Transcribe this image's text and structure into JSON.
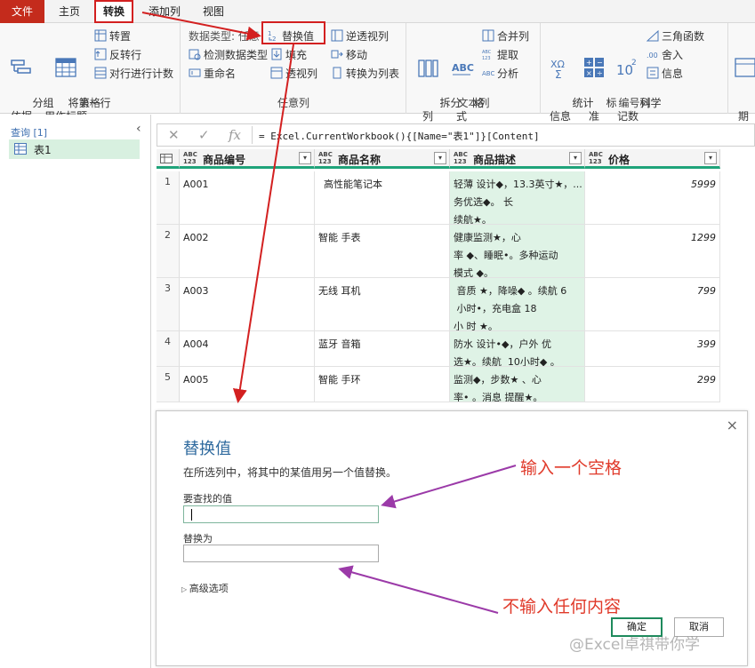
{
  "tabs": {
    "file": "文件",
    "home": "主页",
    "transform": "转换",
    "add_column": "添加列",
    "view": "视图"
  },
  "ribbon": {
    "table_group": {
      "label": "表格",
      "group_by": "分组\n依据",
      "use_first_row": "将第一行\n用作标题",
      "transpose": "转置",
      "reverse_rows": "反转行",
      "count_rows": "对行进行计数"
    },
    "any_column_group": {
      "label": "任意列",
      "data_type": "数据类型: 任意",
      "detect_type": "检测数据类型",
      "rename": "重命名",
      "replace_values": "替换值",
      "fill": "填充",
      "pivot": "透视列",
      "unpivot": "逆透视列",
      "move": "移动",
      "to_list": "转换为列表"
    },
    "text_group": {
      "label": "文本列",
      "split": "拆分\n列",
      "format": "格\n式",
      "merge": "合并列",
      "extract": "提取",
      "parse": "分析"
    },
    "number_group": {
      "label": "编号列",
      "statistics": "统计\n信息",
      "standard": "标\n准",
      "scientific": "科学\n记数",
      "trig": "三角函数",
      "rounding": "舍入",
      "info": "信息"
    },
    "date_group": {
      "date": "日\n期"
    }
  },
  "sidebar": {
    "header": "查询 [1]",
    "query": "表1"
  },
  "formula": {
    "text": "= Excel.CurrentWorkbook(){[Name=\"表1\"]}[Content]"
  },
  "grid": {
    "type_badge": "ABC\n123",
    "headers": [
      "商品编号",
      "商品名称",
      "商品描述",
      "价格"
    ],
    "rows": [
      {
        "n": "1",
        "id": "A001",
        "name": "高性能笔记本",
        "desc": "轻薄 设计◆，13.3英寸★，...\n务优选◆。 长\n续航★。",
        "price": "5999"
      },
      {
        "n": "2",
        "id": "A002",
        "name": "智能 手表",
        "desc": "健康监测★，心\n率 ◆、睡眠•。多种运动\n模式 ◆。",
        "price": "1299"
      },
      {
        "n": "3",
        "id": "A003",
        "name": "无线 耳机",
        "desc": " 音质 ★，降噪◆ 。续航 6\n 小时•，充电盒 18\n小 时 ★。",
        "price": "799"
      },
      {
        "n": "4",
        "id": "A004",
        "name": "蓝牙 音箱",
        "desc": "防水 设计•◆，户外 优\n选★。续航  10小时◆ 。",
        "price": "399"
      },
      {
        "n": "5",
        "id": "A005",
        "name": "智能 手环",
        "desc": "监测◆，步数★ 、心\n率• 。消息 提醒★。",
        "price": "299"
      }
    ]
  },
  "dialog": {
    "title": "替换值",
    "description": "在所选列中，将其中的某值用另一个值替换。",
    "find_label": "要查找的值",
    "find_value": "",
    "replace_label": "替换为",
    "replace_value": "",
    "advanced": "高级选项",
    "ok": "确定",
    "cancel": "取消",
    "close": "×"
  },
  "annotations": {
    "find_note": "输入一个空格",
    "replace_note": "不输入任何内容"
  },
  "watermark": "@Excel卓祺带你学",
  "colors": {
    "accent": "#1fa37a",
    "annotation_red": "#d32020",
    "arrow_purple": "#9b3aa8"
  }
}
